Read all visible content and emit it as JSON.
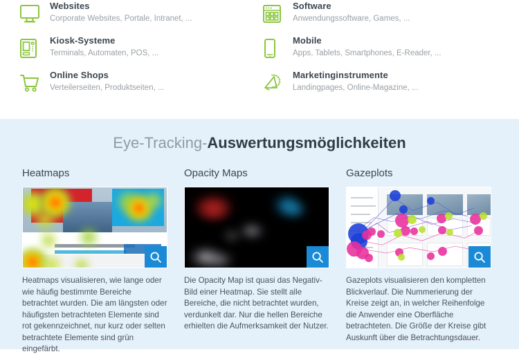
{
  "targets": {
    "items": [
      {
        "icon": "monitor-icon",
        "title": "Websites",
        "subtitle": "Corporate Websites, Portale, Intranet, ..."
      },
      {
        "icon": "app-window-icon",
        "title": "Software",
        "subtitle": "Anwendungssoftware, Games, ..."
      },
      {
        "icon": "kiosk-icon",
        "title": "Kiosk-Systeme",
        "subtitle": "Terminals, Automaten, POS, ..."
      },
      {
        "icon": "smartphone-icon",
        "title": "Mobile",
        "subtitle": "Apps, Tablets, Smartphones, E-Reader, ..."
      },
      {
        "icon": "shopping-cart-icon",
        "title": "Online Shops",
        "subtitle": "Verteilerseiten, Produktseiten, ..."
      },
      {
        "icon": "megaphone-icon",
        "title": "Marketinginstrumente",
        "subtitle": "Landingpages, Online-Magazine, ..."
      }
    ]
  },
  "panel": {
    "heading_light": "Eye-Tracking-",
    "heading_strong": "Auswertungsmöglichkeiten",
    "background_color": "#e4f0fa",
    "accent_color": "#1b8ad6",
    "icon_color": "#8cc63f",
    "columns": [
      {
        "title": "Heatmaps",
        "image_alt": "Heatmap eines Parkplatz-Reservierungs-Banners der Hannover Airport Website",
        "zoom_button_label": "search-icon",
        "description": "Heatmaps visualisieren, wie lange oder wie häufig bestimmte Bereiche betrachtet wurden. Die am längsten oder häufigsten betrachteten Elemente sind rot gekennzeichnet, nur kurz oder selten betrachtete Elemente sind grün eingefärbt."
      },
      {
        "title": "Opacity Maps",
        "image_alt": "Opacity Map: schwarz abgedunkelte Seite mit hellen betrachteten Bereichen",
        "zoom_button_label": "search-icon",
        "description": "Die Opacity Map ist quasi das Negativ-Bild einer Heatmap. Sie stellt alle Bereiche, die nicht betrachtet wurden, verdunkelt dar. Nur die hellen Bereiche erhielten die Aufmerksamkeit der Nutzer."
      },
      {
        "title": "Gazeplots",
        "image_alt": "Gazeplot mit nummerierten Kreisen und Blickpfaden auf einer Airport-Website",
        "zoom_button_label": "search-icon",
        "description": "Gazeplots visualisieren den kompletten Blickverlauf. Die Nummerierung der Kreise zeigt an, in welcher Reihenfolge die Anwender eine Oberfläche betrachteten. Die Größe der Kreise gibt Auskunft über die Betrachtungsdauer."
      }
    ]
  }
}
